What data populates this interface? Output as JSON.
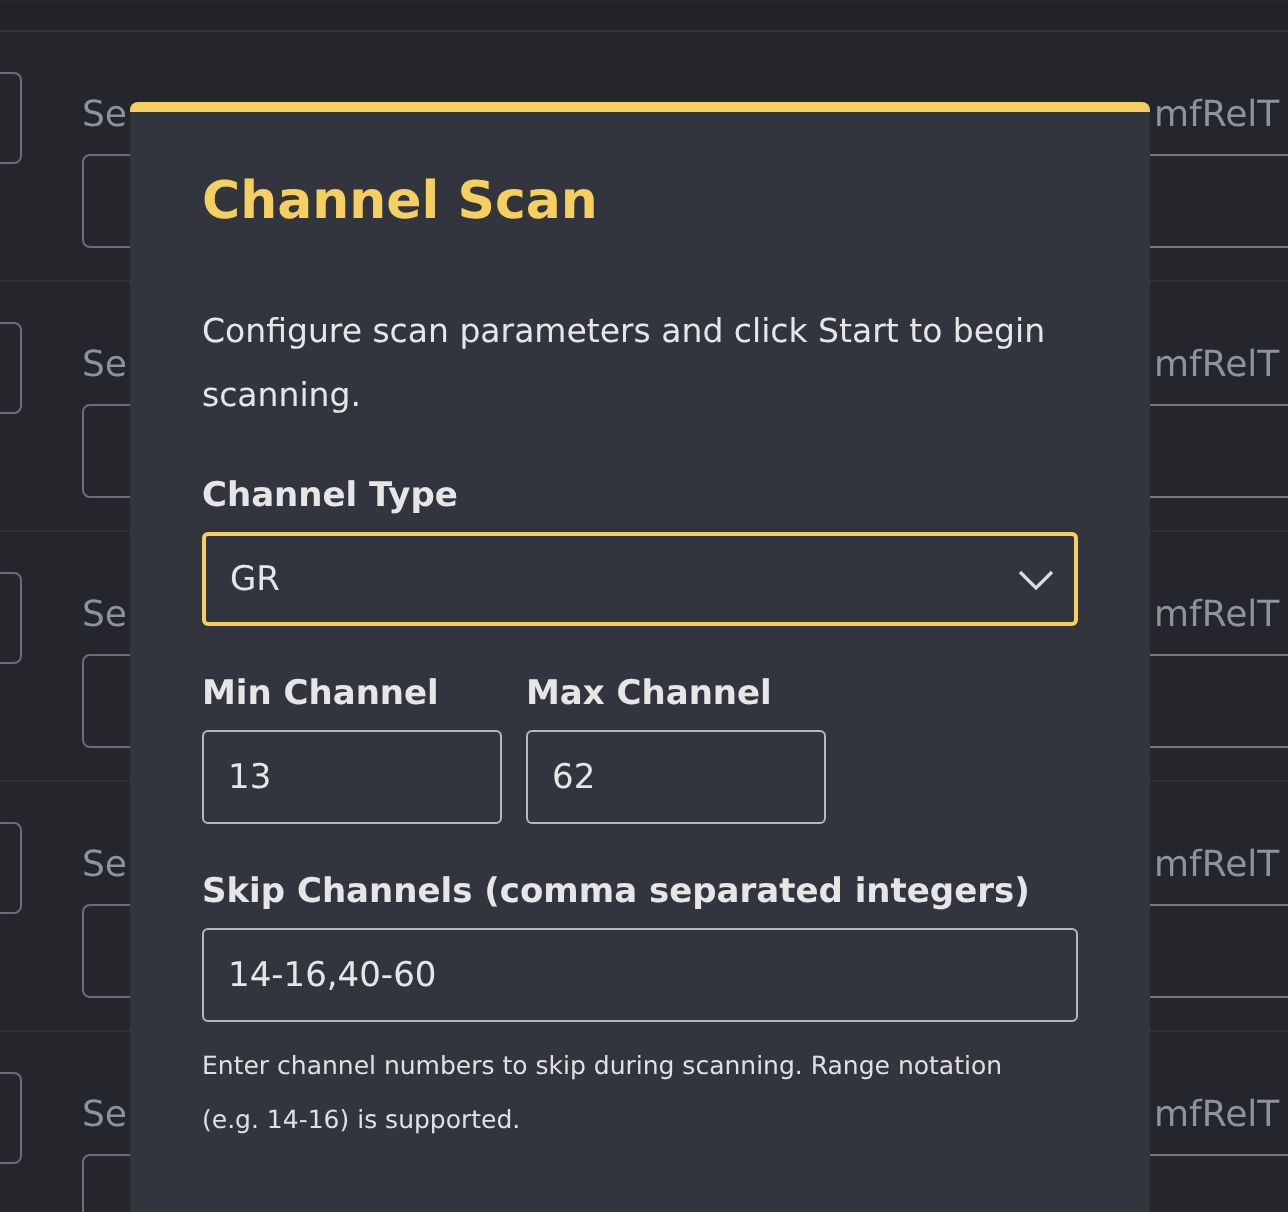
{
  "background_rows": [
    {
      "label": "Se",
      "right_label": "mfRelT"
    },
    {
      "label": "Se",
      "right_label": "mfRelT"
    },
    {
      "label": "Se",
      "right_label": "mfRelT"
    },
    {
      "label": "Se",
      "right_label": "mfRelT"
    },
    {
      "label": "Se",
      "right_label": "mfRelT"
    }
  ],
  "dialog": {
    "title": "Channel Scan",
    "description": "Configure scan parameters and click Start to begin scanning.",
    "channel_type": {
      "label": "Channel Type",
      "value": "GR",
      "focused": true
    },
    "min_channel": {
      "label": "Min Channel",
      "value": "13"
    },
    "max_channel": {
      "label": "Max Channel",
      "value": "62"
    },
    "skip_channels": {
      "label": "Skip Channels (comma separated integers)",
      "value": "14-16,40-60",
      "help": "Enter channel numbers to skip during scanning. Range notation (e.g. 14-16) is supported."
    }
  }
}
